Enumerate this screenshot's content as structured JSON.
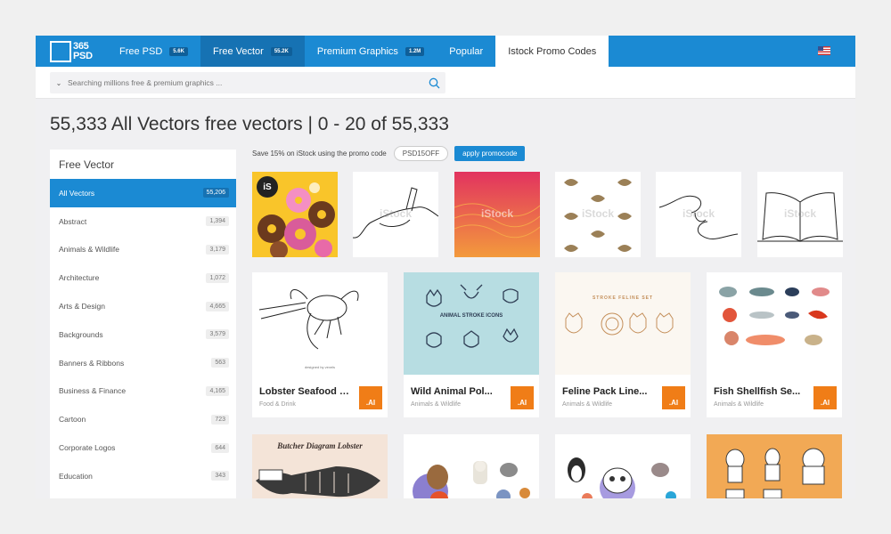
{
  "logo": {
    "line1": "365",
    "line2": "PSD"
  },
  "nav": [
    {
      "label": "Free PSD",
      "badge": "5.6K"
    },
    {
      "label": "Free Vector",
      "badge": "55.2K"
    },
    {
      "label": "Premium Graphics",
      "badge": "1.2M"
    },
    {
      "label": "Popular",
      "badge": ""
    },
    {
      "label": "Istock Promo Codes",
      "badge": ""
    }
  ],
  "search": {
    "placeholder": "Searching millions free & premium graphics ..."
  },
  "page_title": "55,333 All Vectors free vectors | 0 - 20 of 55,333",
  "sidebar": {
    "title": "Free Vector",
    "items": [
      {
        "label": "All Vectors",
        "count": "55,206"
      },
      {
        "label": "Abstract",
        "count": "1,394"
      },
      {
        "label": "Animals & Wildlife",
        "count": "3,179"
      },
      {
        "label": "Architecture",
        "count": "1,072"
      },
      {
        "label": "Arts & Design",
        "count": "4,665"
      },
      {
        "label": "Backgrounds",
        "count": "3,579"
      },
      {
        "label": "Banners & Ribbons",
        "count": "563"
      },
      {
        "label": "Business & Finance",
        "count": "4,165"
      },
      {
        "label": "Cartoon",
        "count": "723"
      },
      {
        "label": "Corporate Logos",
        "count": "644"
      },
      {
        "label": "Education",
        "count": "343"
      }
    ]
  },
  "promo": {
    "text": "Save 15% on iStock using the promo code",
    "code": "PSD15OFF",
    "button": "apply promocode"
  },
  "istock": {
    "watermark": "iStock",
    "badge": "iS"
  },
  "cards": [
    {
      "title": "Lobster Seafood Engraving",
      "category": "Food & Drink",
      "badge": ".AI",
      "img_caption": "designed by vexels"
    },
    {
      "title": "Wild Animal Pol...",
      "category": "Animals & Wildlife",
      "badge": ".AI",
      "img_caption": "ANIMAL STROKE ICONS"
    },
    {
      "title": "Feline Pack Line...",
      "category": "Animals & Wildlife",
      "badge": ".AI",
      "img_caption": "STROKE FELINE SET"
    },
    {
      "title": "Fish Shellfish Se...",
      "category": "Animals & Wildlife",
      "badge": ".AI",
      "img_caption": ""
    },
    {
      "title": "",
      "category": "",
      "badge": "",
      "img_caption": "Butcher Diagram Lobster"
    },
    {
      "title": "",
      "category": "",
      "badge": "",
      "img_caption": ""
    },
    {
      "title": "",
      "category": "",
      "badge": "",
      "img_caption": ""
    },
    {
      "title": "",
      "category": "",
      "badge": "",
      "img_caption": ""
    }
  ]
}
